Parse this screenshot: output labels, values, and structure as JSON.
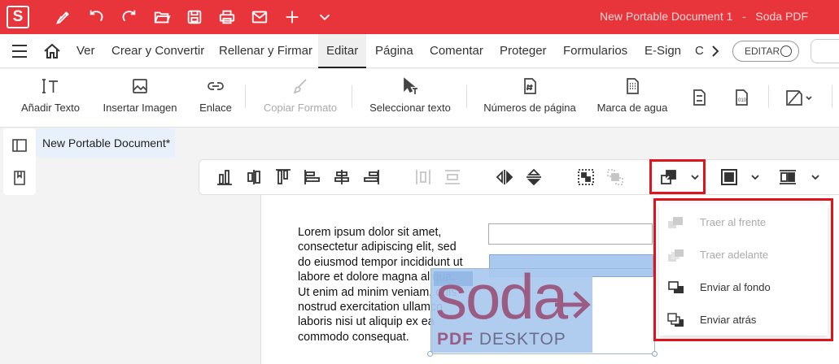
{
  "app": {
    "logo_letter": "S",
    "window_title": "New Portable Document 1   -   Soda PDF",
    "accent_color": "#e8353c",
    "titlebar_icons": [
      "pen-icon",
      "undo-icon",
      "redo-icon",
      "open-folder-icon",
      "save-icon",
      "print-icon",
      "mail-icon",
      "plus-icon",
      "chevron-down-icon"
    ]
  },
  "menubar": {
    "tabs": [
      "Ver",
      "Crear y Convertir",
      "Rellenar y Firmar",
      "Editar",
      "Página",
      "Comentar",
      "Proteger",
      "Formularios",
      "E-Sign",
      "C"
    ],
    "active_tab": "Editar",
    "editar_toggle": "EDITAR"
  },
  "ribbon": {
    "items": [
      {
        "label": "Añadir Texto",
        "icon": "text-cursor-icon",
        "enabled": true
      },
      {
        "label": "Insertar Imagen",
        "icon": "image-icon",
        "enabled": true
      },
      {
        "label": "Enlace",
        "icon": "link-icon",
        "enabled": true
      },
      {
        "label": "Copiar Formato",
        "icon": "brush-icon",
        "enabled": false
      },
      {
        "label": "Seleccionar texto",
        "icon": "select-text-icon",
        "enabled": true
      },
      {
        "label": "Números de página",
        "icon": "page-number-icon",
        "enabled": true
      },
      {
        "label": "Marca de agua",
        "icon": "watermark-icon",
        "enabled": true
      }
    ],
    "extra_icons": [
      "header-footer-icon",
      "bates-icon",
      "redact-icon"
    ]
  },
  "document": {
    "tab_label": "New Portable Document*",
    "body_text": "Lorem ipsum dolor sit amet,\nconsectetur adipiscing elit, sed\ndo eiusmod tempor incididunt ut\nlabore et dolore magna aliqua.\nUt enim ad minim veniam, quis\nnostrud exercitation ullamco\nlaboris nisi ut aliquip ex ea\ncommodo consequat.",
    "logo_word": "soda",
    "logo_sub_bold": "PDF",
    "logo_sub": " DESKTOP"
  },
  "arrange_menu": {
    "items": [
      {
        "label": "Traer al frente",
        "enabled": false
      },
      {
        "label": "Traer adelante",
        "enabled": false
      },
      {
        "label": "Enviar al fondo",
        "enabled": true
      },
      {
        "label": "Enviar atrás",
        "enabled": true
      }
    ]
  }
}
